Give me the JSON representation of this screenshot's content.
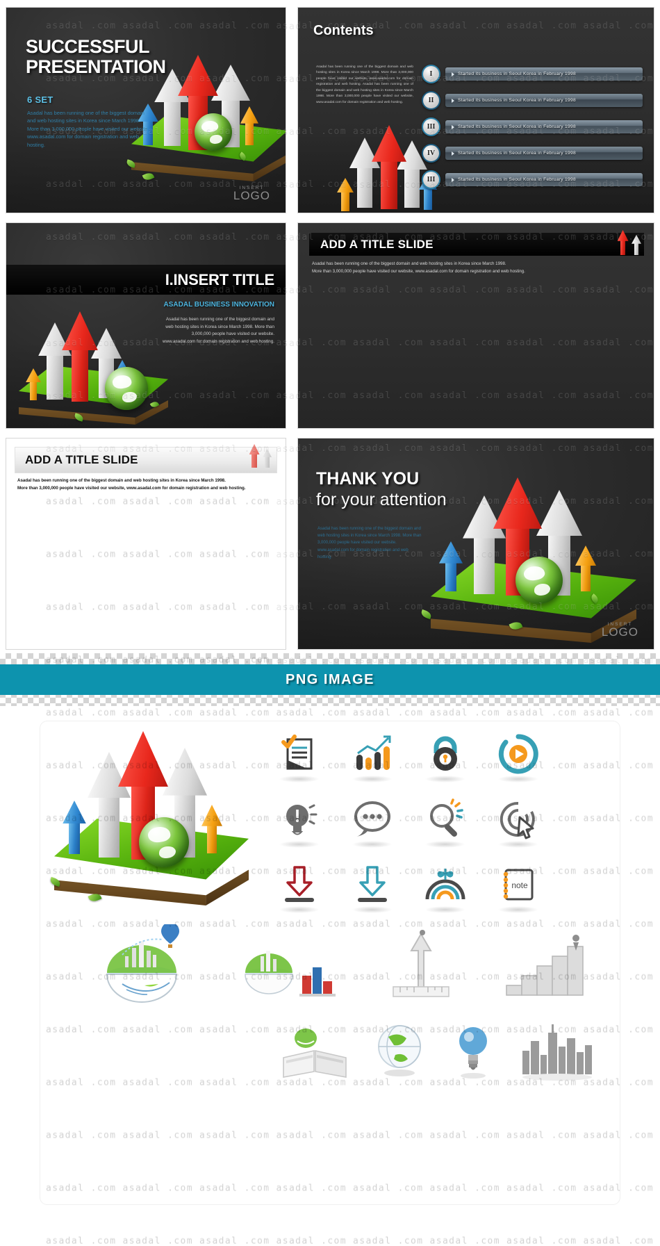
{
  "meta": {
    "watermark_text": "asadal .com"
  },
  "slides": [
    {
      "id": "slide-cover",
      "title_line1": "SUCCESSFUL",
      "title_line2": "PRESENTATION",
      "subtitle": "6 SET",
      "body": "Asadal has been running one of the biggest domain and web hosting sites in Korea since March 1998. More than 3,000,000 people have visited our website. www.asadal.com for domain registration and web hosting.",
      "logo_insert": "INSERT",
      "logo_text": "LOGO"
    },
    {
      "id": "slide-contents",
      "title": "Contents",
      "body": "Asadal has been running one of the biggest domain and web hosting sites in Korea since March 1998. More than 3,000,000 people have visited our website, www.asadal.com for domain registration and web hosting. Asadal has been running one of the biggest domain and web hosting sites in Korea since March 1998. More than 3,000,000 people have visited our website, www.asadal.com for domain registration and web hosting.",
      "items": [
        {
          "numeral": "I",
          "text": "Started its business in Seoul Korea in February 1998"
        },
        {
          "numeral": "II",
          "text": "Started its business in Seoul Korea in February 1998"
        },
        {
          "numeral": "III",
          "text": "Started its business in Seoul Korea in February 1998"
        },
        {
          "numeral": "IV",
          "text": "Started its business in Seoul Korea in February 1998"
        },
        {
          "numeral": "III",
          "text": "Started its business in Seoul Korea in February 1998"
        }
      ]
    },
    {
      "id": "slide-section",
      "title": "I.INSERT TITLE",
      "subtitle": "ASADAL BUSINESS INNOVATION",
      "body": "Asadal has been running one of the biggest domain and web hosting sites in Korea since March 1998. More than 3,000,000 people have visited our website. www.asadal.com for domain  registration and web hosting."
    },
    {
      "id": "slide-title-dark",
      "title": "ADD A TITLE SLIDE",
      "body_line1": "Asadal has been running one of the biggest domain and web hosting sites in Korea since March 1998.",
      "body_line2": "More than 3,000,000 people have visited our website,  www.asadal.com for domain registration and web hosting."
    },
    {
      "id": "slide-title-light",
      "title": "ADD A TITLE SLIDE",
      "body_line1": "Asadal has been running one of the biggest domain and web hosting sites in Korea since March 1998.",
      "body_line2": "More than 3,000,000 people have visited our website,  www.asadal.com for domain registration and web hosting."
    },
    {
      "id": "slide-thankyou",
      "title_line1": "THANK YOU",
      "title_line2": "for your attention",
      "body": "Asadal has been running one of the biggest domain and web hosting sites in Korea since March 1998. More than 3,000,000 people have visited our website. www.asadal.com for domain registration and web hosting.",
      "logo_insert": "INSERT",
      "logo_text": "LOGO"
    }
  ],
  "png_section": {
    "banner_title": "PNG IMAGE",
    "banner_color": "#0d93ae",
    "accent_orange": "#f5991d",
    "accent_teal": "#37a0b5",
    "accent_dark": "#3b3b3b",
    "note_label": "note",
    "icons": [
      "checklist-document-icon",
      "bar-chart-growth-icon",
      "padlock-icon",
      "play-circle-icon",
      "lightbulb-idea-icon",
      "speech-bubble-icon",
      "magnifier-search-icon",
      "cursor-click-target-icon",
      "download-arrow-red-icon",
      "download-arrow-teal-icon",
      "sprout-rainbow-icon",
      "note-pad-icon",
      "eco-city-globe-icon",
      "globe-city-bar-chart-icon",
      "arrow-ruler-icon",
      "staircase-growth-icon",
      "open-book-icon",
      "world-globe-icon",
      "light-bulb-blue-icon",
      "city-skyline-icon"
    ]
  }
}
